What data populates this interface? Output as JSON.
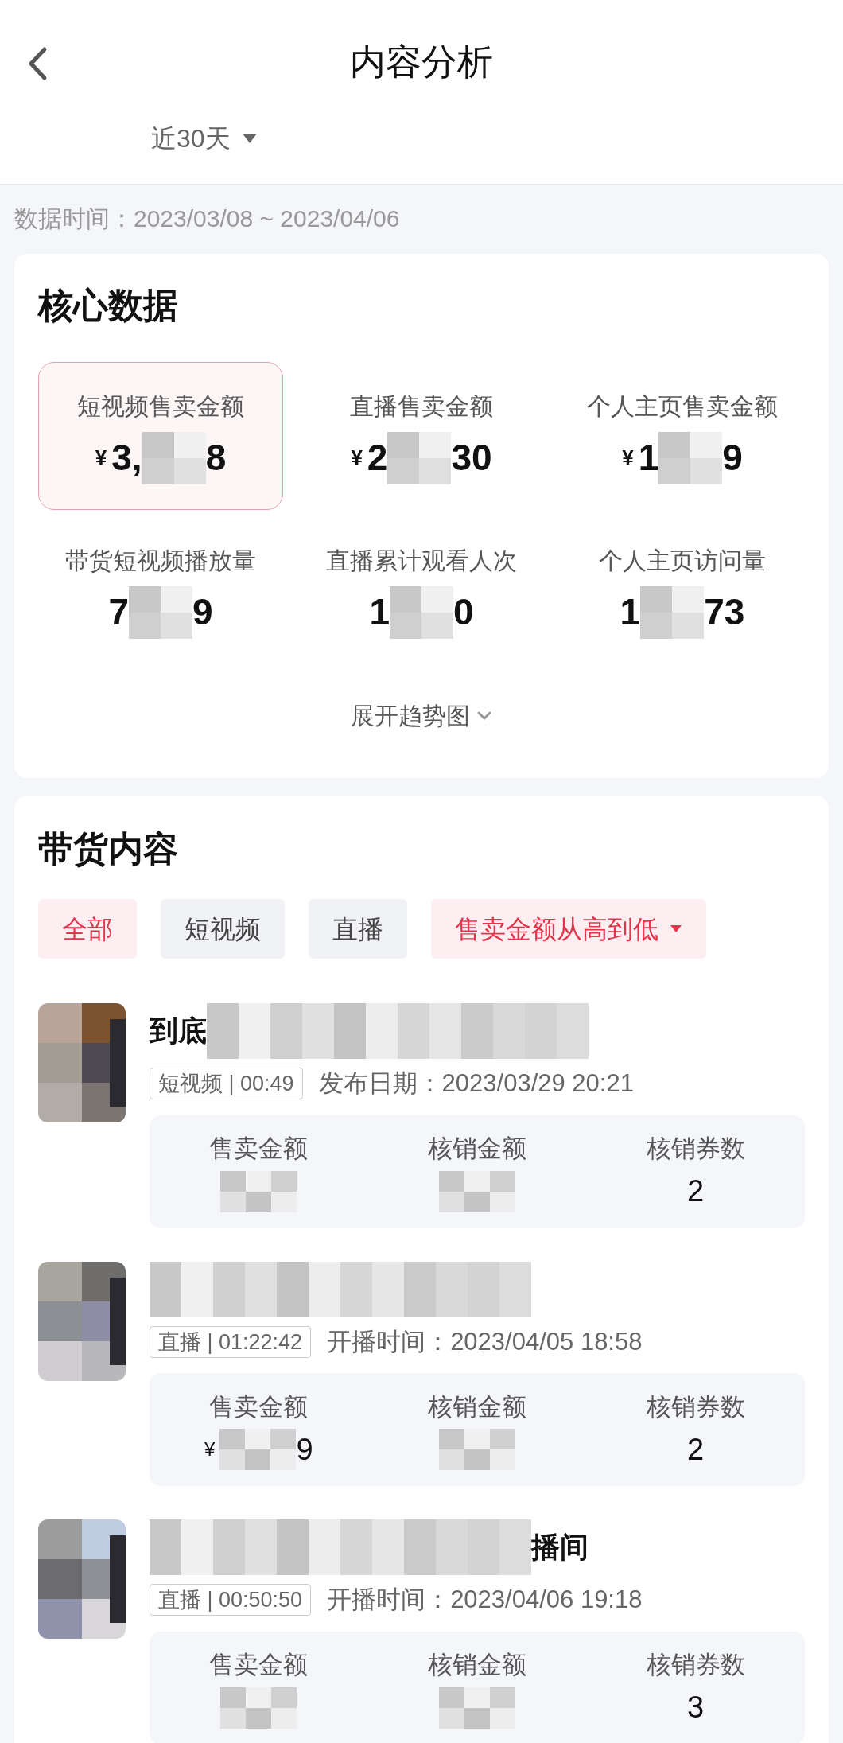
{
  "header": {
    "title": "内容分析"
  },
  "period": {
    "label": "近30天"
  },
  "data_time": "数据时间：2023/03/08 ~ 2023/04/06",
  "core": {
    "title": "核心数据",
    "metrics": [
      {
        "label": "短视频售卖金额",
        "currency": "¥",
        "start": "3,",
        "end": "8",
        "redacted": true,
        "selected": true
      },
      {
        "label": "直播售卖金额",
        "currency": "¥",
        "start": "2",
        "end": "30",
        "redacted": true,
        "selected": false
      },
      {
        "label": "个人主页售卖金额",
        "currency": "¥",
        "start": "1",
        "end": "9",
        "redacted": true,
        "selected": false
      },
      {
        "label": "带货短视频播放量",
        "start": "7",
        "end": "9",
        "redacted": true,
        "selected": false
      },
      {
        "label": "直播累计观看人次",
        "start": "1",
        "end": "0",
        "redacted": true,
        "selected": false
      },
      {
        "label": "个人主页访问量",
        "start": "1",
        "end": "73",
        "redacted": true,
        "selected": false
      }
    ],
    "expand": "展开趋势图"
  },
  "content": {
    "title": "带货内容",
    "filters": [
      {
        "label": "全部",
        "selected": true,
        "kind": "tab"
      },
      {
        "label": "短视频",
        "selected": false,
        "kind": "tab"
      },
      {
        "label": "直播",
        "selected": false,
        "kind": "tab"
      },
      {
        "label": "售卖金额从高到低",
        "selected": true,
        "kind": "sort"
      }
    ],
    "items": [
      {
        "title": {
          "start": "到底",
          "redacted": true
        },
        "tag": "短视频 | 00:49",
        "date": "发布日期：2023/03/29 20:21",
        "stats": [
          {
            "label": "售卖金额",
            "redacted": true
          },
          {
            "label": "核销金额",
            "redacted": true
          },
          {
            "label": "核销券数",
            "end": "2"
          }
        ]
      },
      {
        "title": {
          "redacted": true
        },
        "tag": "直播 | 01:22:42",
        "date": "开播时间：2023/04/05 18:58",
        "stats": [
          {
            "label": "售卖金额",
            "currency": "¥",
            "end": "9",
            "redacted": true
          },
          {
            "label": "核销金额",
            "redacted": true
          },
          {
            "label": "核销券数",
            "end": "2"
          }
        ]
      },
      {
        "title": {
          "end": "播间",
          "redacted": true
        },
        "tag": "直播 | 00:50:50",
        "date": "开播时间：2023/04/06 19:18",
        "stats": [
          {
            "label": "售卖金额",
            "redacted": true
          },
          {
            "label": "核销金额",
            "redacted": true
          },
          {
            "label": "核销券数",
            "end": "3"
          }
        ]
      }
    ]
  }
}
